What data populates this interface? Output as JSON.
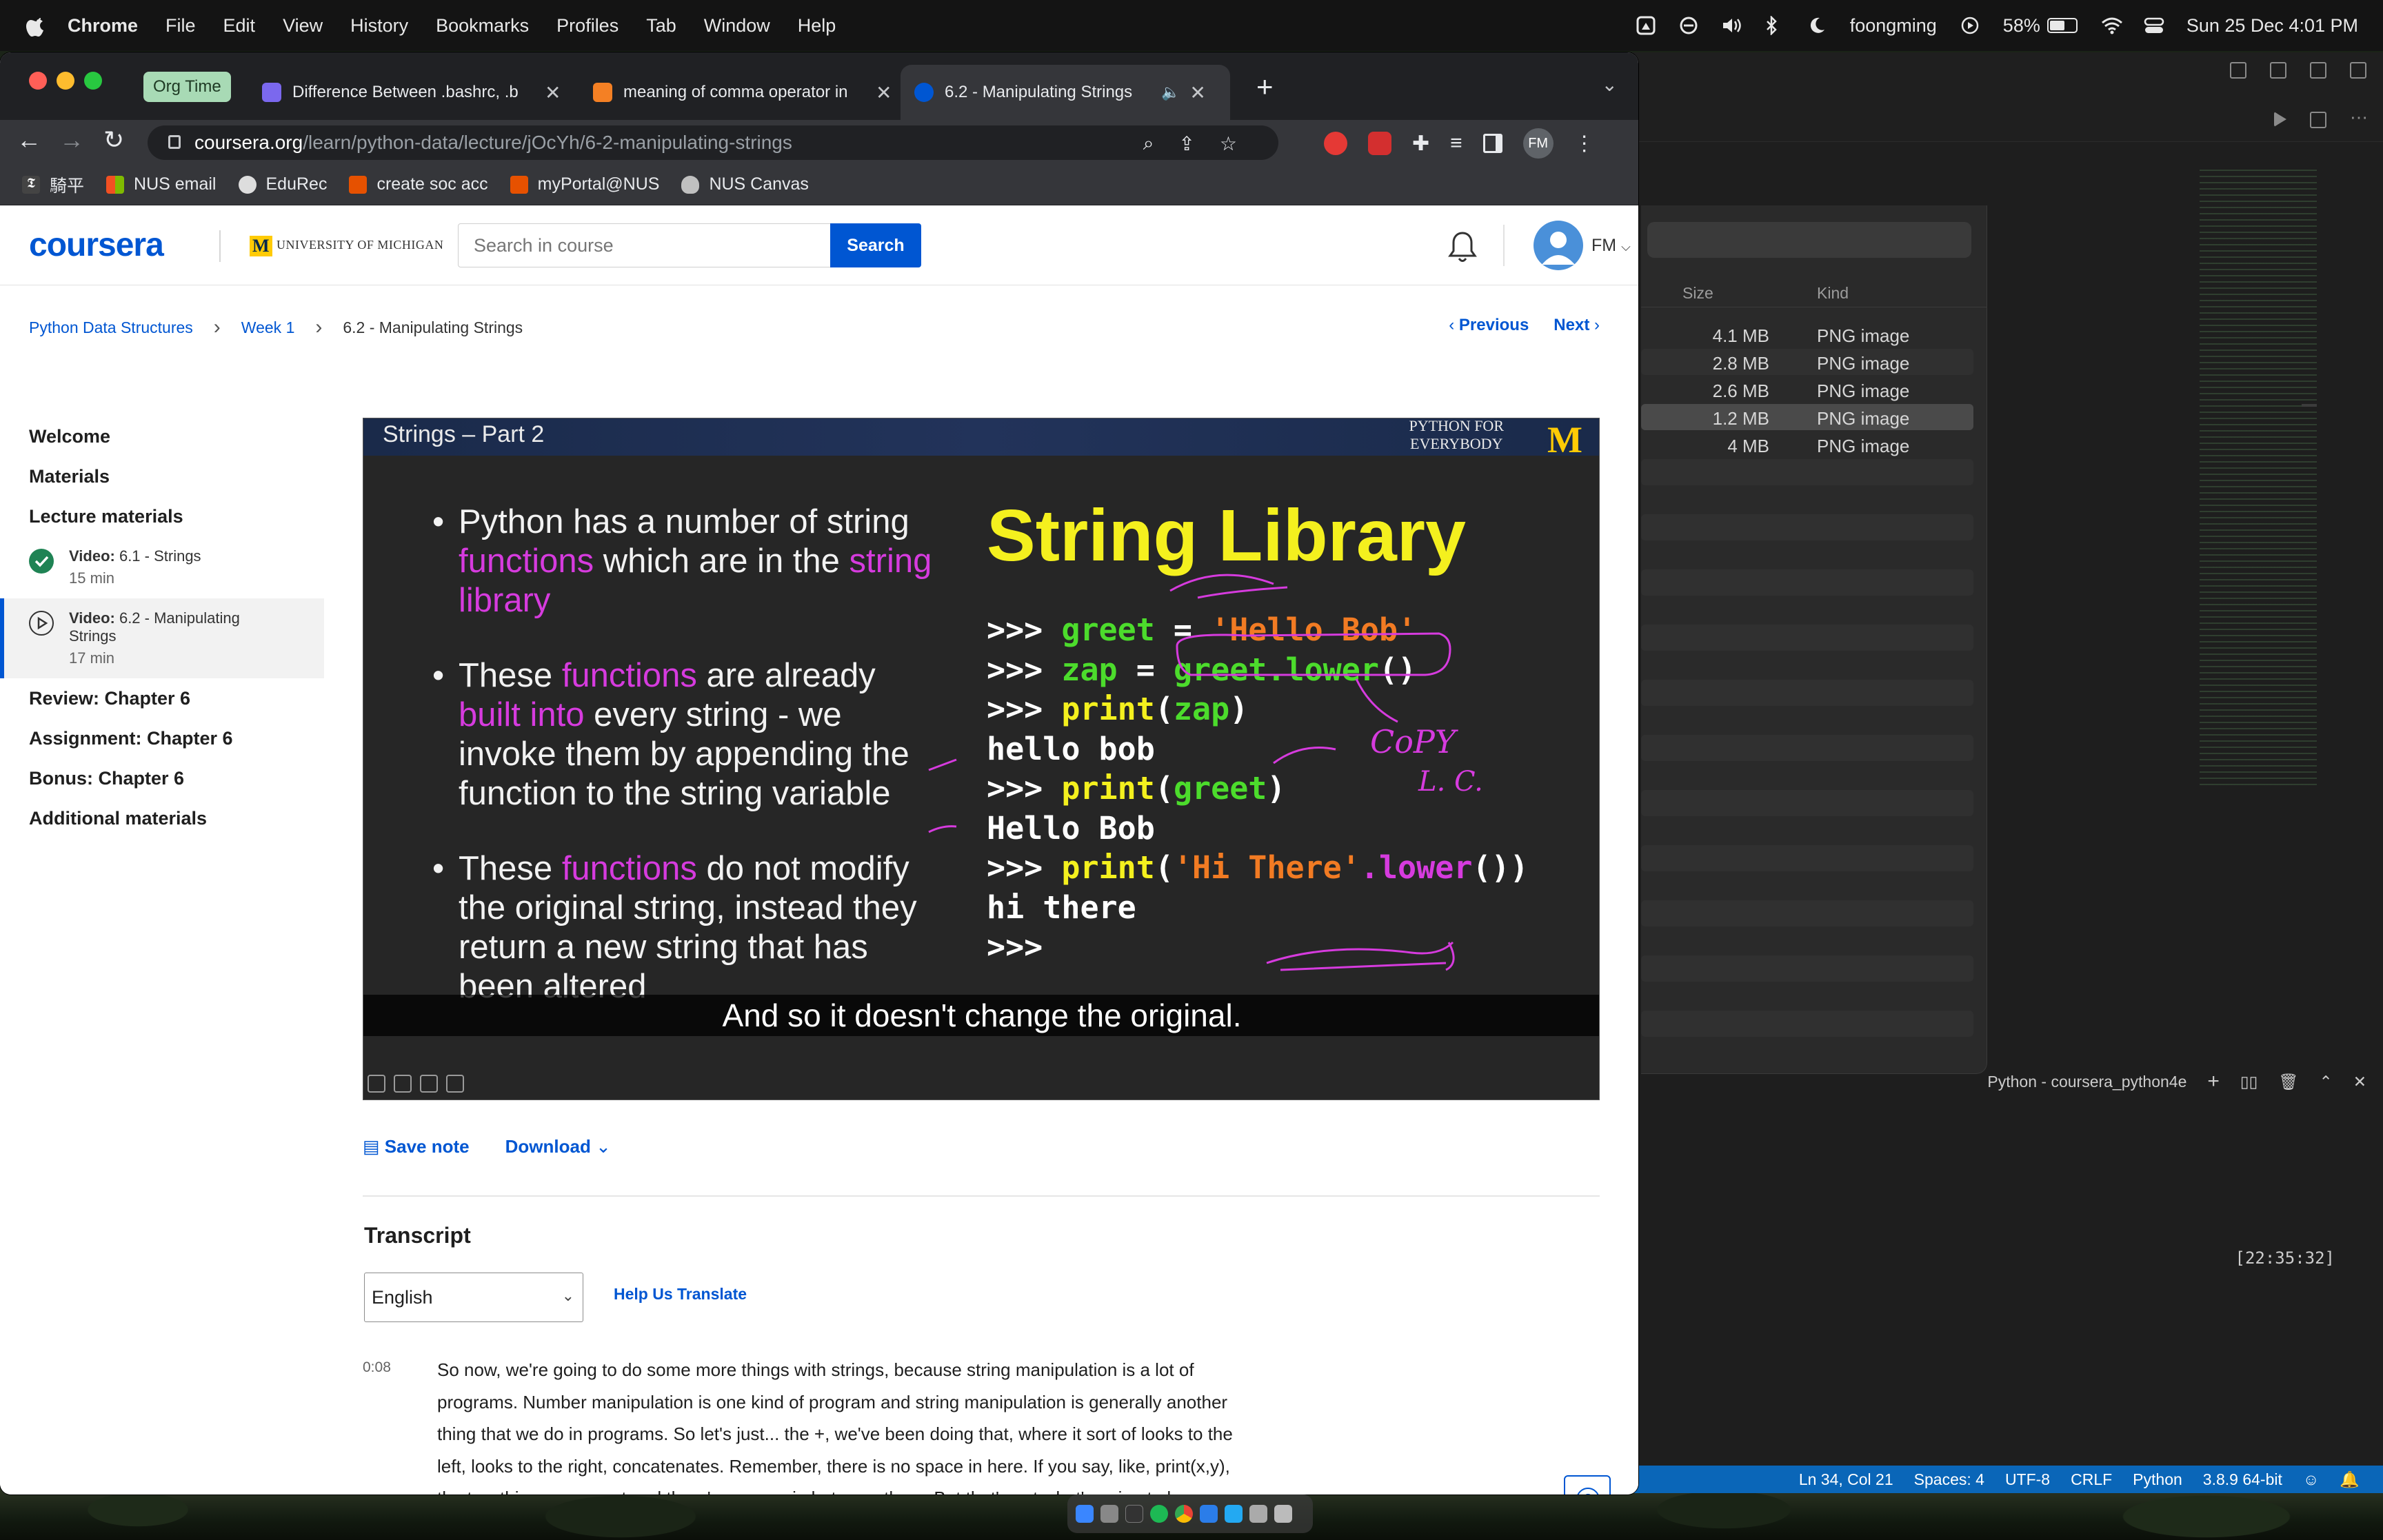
{
  "menubar": {
    "app": "Chrome",
    "items": [
      "File",
      "Edit",
      "View",
      "History",
      "Bookmarks",
      "Profiles",
      "Tab",
      "Window",
      "Help"
    ],
    "user": "foongming",
    "battery": "58%",
    "battery_level": 0.58,
    "clock": "Sun 25 Dec  4:01 PM"
  },
  "chrome": {
    "tab_group": "Org Time",
    "tabs": [
      {
        "title": "Difference Between .bashrc, .b"
      },
      {
        "title": "meaning of comma operator in"
      },
      {
        "title": "6.2 - Manipulating Strings"
      }
    ],
    "url_host": "coursera.org",
    "url_path": "/learn/python-data/lecture/jOcYh/6-2-manipulating-strings",
    "profile_initials": "FM",
    "bookmarks": [
      "騎平",
      "NUS email",
      "EduRec",
      "create soc acc",
      "myPortal@NUS",
      "NUS Canvas"
    ]
  },
  "header": {
    "logo": "coursera",
    "partner": "UNIVERSITY OF MICHIGAN",
    "search_placeholder": "Search in course",
    "search_button": "Search",
    "user_initials": "FM"
  },
  "breadcrumb": {
    "items": [
      "Python Data Structures",
      "Week 1",
      "6.2 - Manipulating Strings"
    ],
    "previous": "Previous",
    "next": "Next"
  },
  "sidebar": {
    "welcome": "Welcome",
    "materials": "Materials",
    "lecture_materials": "Lecture materials",
    "items": [
      {
        "prefix": "Video:",
        "title": "6.1 - Strings",
        "meta": "15 min",
        "done": true
      },
      {
        "prefix": "Video:",
        "title": "6.2 - Manipulating Strings",
        "meta": "17 min",
        "done": false
      }
    ],
    "sections": [
      "Review: Chapter 6",
      "Assignment: Chapter 6",
      "Bonus: Chapter 6",
      "Additional materials"
    ]
  },
  "slide": {
    "header_title": "Strings – Part 2",
    "brand_line1": "PYTHON FOR",
    "brand_line2": "EVERYBODY",
    "brand_mark": "M",
    "title": "String Library",
    "bullets": [
      {
        "parts": [
          "Python has a number of string ",
          "functions",
          " which are in the ",
          "string library"
        ]
      },
      {
        "parts": [
          "These ",
          "functions",
          " are already ",
          "built into",
          " every string - we invoke them by appending the function to the string variable"
        ]
      },
      {
        "parts": [
          "These ",
          "functions",
          " do not modify the original string, instead they return a new string that has been altered"
        ]
      }
    ],
    "code": [
      ">>> greet = 'Hello Bob'",
      ">>> zap = greet.lower()",
      ">>> print(zap)",
      "hello bob",
      ">>> print(greet)",
      "Hello Bob",
      ">>> print('Hi There'.lower())",
      "hi there",
      ">>>"
    ],
    "annotation": "Copy L.C.",
    "caption": "And so it doesn't change the original."
  },
  "actions": {
    "save_note": "Save note",
    "download": "Download"
  },
  "transcript": {
    "heading": "Transcript",
    "language": "English",
    "help_translate": "Help Us Translate",
    "timestamp": "0:08",
    "text": "So now, we're going to do some more things with strings, because string manipulation is a lot of programs. Number manipulation is one kind of program and string manipulation is generally another thing that we do in programs. So let's just... the +, we've been doing that, where it sort of looks to the left, looks to the right, concatenates. Remember, there is no space in here. If you say, like, print(x,y), the two things come out and there's a space in between them. But that's not what's going to happen here. This + says concatenate these two things and it literally does it. So"
  },
  "finder": {
    "col_size": "Size",
    "col_kind": "Kind",
    "rows": [
      {
        "size": "4.1 MB",
        "kind": "PNG image"
      },
      {
        "size": "2.8 MB",
        "kind": "PNG image"
      },
      {
        "size": "2.6 MB",
        "kind": "PNG image"
      },
      {
        "size": "1.2 MB",
        "kind": "PNG image"
      },
      {
        "size": "4 MB",
        "kind": "PNG image"
      }
    ]
  },
  "vscode": {
    "terminal_title": "Python - coursera_python4e",
    "terminal_time": "[22:35:32]",
    "status": [
      "Ln 34, Col 21",
      "Spaces: 4",
      "UTF-8",
      "CRLF",
      "Python",
      "3.8.9 64-bit"
    ]
  },
  "colors": {
    "coursera_blue": "#0056d2",
    "slide_yellow": "#f4f01e",
    "slide_green": "#4cdc2c",
    "slide_orange": "#f27b23",
    "slide_magenta": "#d63bde",
    "vscode_status": "#0a66b8"
  },
  "icons": [
    "apple-icon",
    "notification-bell-icon",
    "search-icon",
    "lock-icon",
    "star-icon",
    "extensions-icon",
    "help-icon",
    "checkmark-icon",
    "play-circle-icon",
    "chevron-down-icon"
  ]
}
